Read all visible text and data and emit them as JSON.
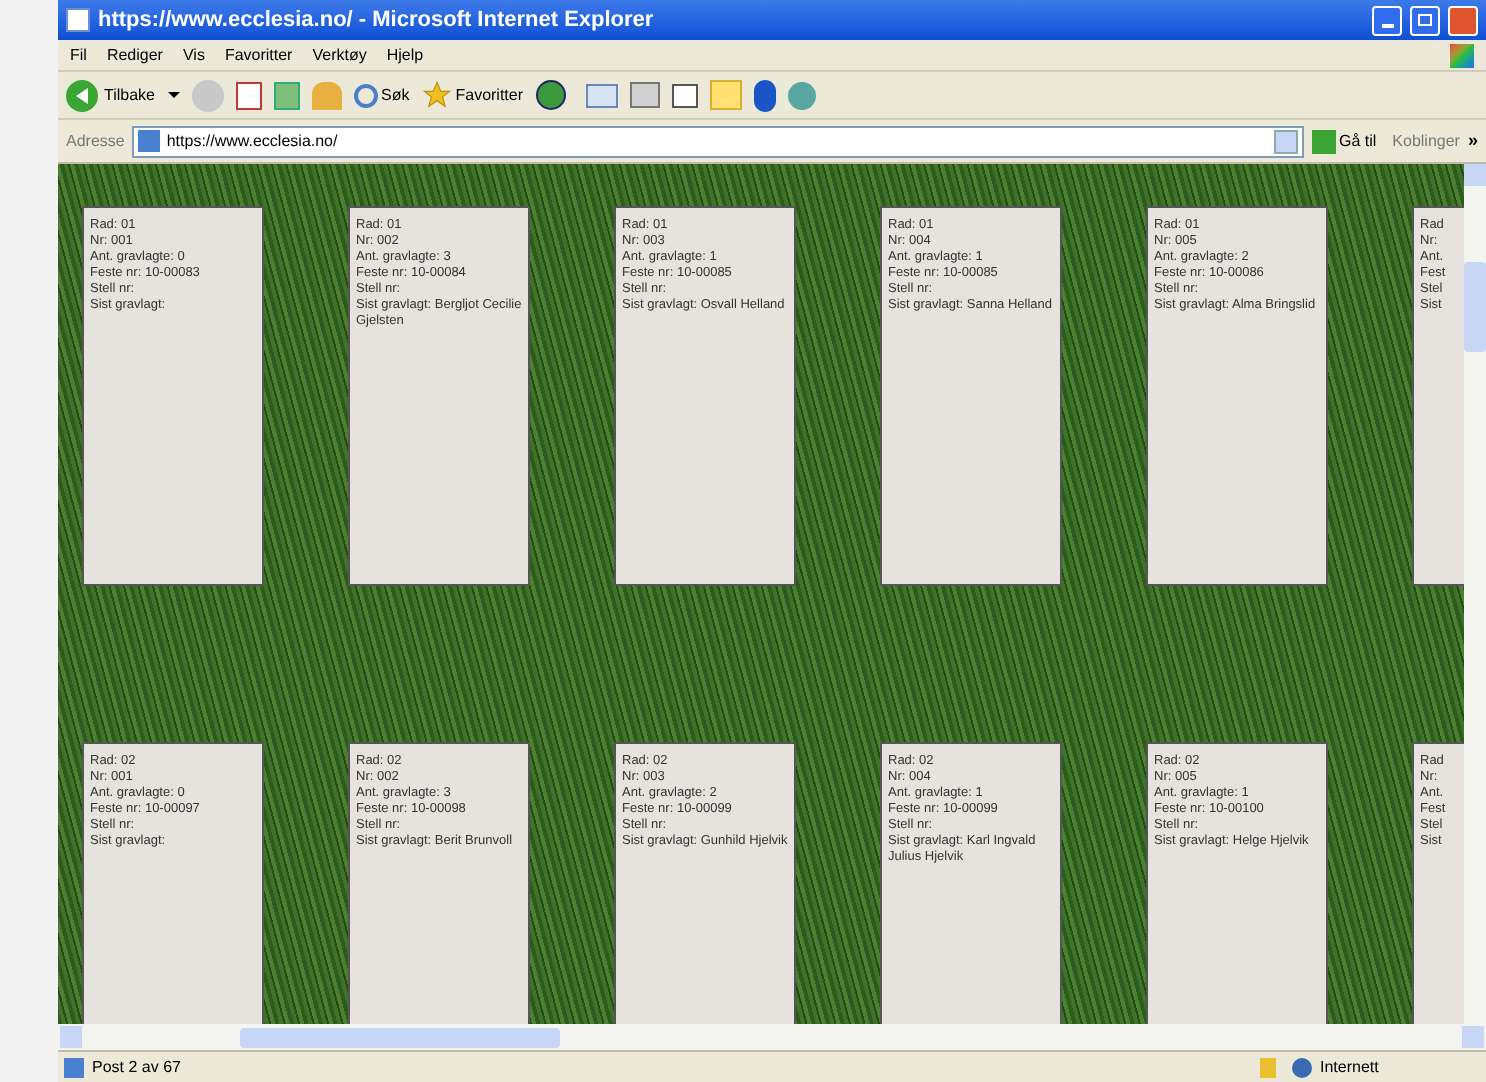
{
  "window": {
    "title": "https://www.ecclesia.no/ - Microsoft Internet Explorer"
  },
  "menu": [
    "Fil",
    "Rediger",
    "Vis",
    "Favoritter",
    "Verktøy",
    "Hjelp"
  ],
  "toolbar": {
    "back": "Tilbake",
    "search": "Søk",
    "favorites": "Favoritter"
  },
  "address": {
    "label": "Adresse",
    "value": "https://www.ecclesia.no/",
    "go": "Gå til",
    "links": "Koblinger",
    "more": "»"
  },
  "rows": [
    {
      "cards": [
        {
          "lines": [
            "Rad: 01",
            "Nr: 001",
            "Ant. gravlagte: 0",
            "Feste nr: 10-00083",
            "Stell nr:",
            "Sist gravlagt:"
          ]
        },
        {
          "lines": [
            "Rad: 01",
            "Nr: 002",
            "Ant. gravlagte: 3",
            "Feste nr: 10-00084",
            "Stell nr:",
            "Sist gravlagt: Bergljot Cecilie Gjelsten"
          ]
        },
        {
          "lines": [
            "Rad: 01",
            "Nr: 003",
            "Ant. gravlagte: 1",
            "Feste nr: 10-00085",
            "Stell nr:",
            "Sist gravlagt: Osvall Helland"
          ]
        },
        {
          "lines": [
            "Rad: 01",
            "Nr: 004",
            "Ant. gravlagte: 1",
            "Feste nr: 10-00085",
            "Stell nr:",
            "Sist gravlagt: Sanna Helland"
          ]
        },
        {
          "lines": [
            "Rad: 01",
            "Nr: 005",
            "Ant. gravlagte: 2",
            "Feste nr: 10-00086",
            "Stell nr:",
            "Sist gravlagt: Alma Bringslid"
          ]
        },
        {
          "lines": [
            "Rad",
            "Nr:",
            "Ant.",
            "Fest",
            "Stel",
            "Sist"
          ]
        }
      ]
    },
    {
      "cards": [
        {
          "lines": [
            "Rad: 02",
            "Nr: 001",
            "Ant. gravlagte: 0",
            "Feste nr: 10-00097",
            "Stell nr:",
            "Sist gravlagt:"
          ]
        },
        {
          "lines": [
            "Rad: 02",
            "Nr: 002",
            "Ant. gravlagte: 3",
            "Feste nr: 10-00098",
            "Stell nr:",
            "Sist gravlagt: Berit Brunvoll"
          ]
        },
        {
          "lines": [
            "Rad: 02",
            "Nr: 003",
            "Ant. gravlagte: 2",
            "Feste nr: 10-00099",
            "Stell nr:",
            "Sist gravlagt: Gunhild Hjelvik"
          ]
        },
        {
          "lines": [
            "Rad: 02",
            "Nr: 004",
            "Ant. gravlagte: 1",
            "Feste nr: 10-00099",
            "Stell nr:",
            "Sist gravlagt: Karl Ingvald Julius Hjelvik"
          ]
        },
        {
          "lines": [
            "Rad: 02",
            "Nr: 005",
            "Ant. gravlagte: 1",
            "Feste nr: 10-00100",
            "Stell nr:",
            "Sist gravlagt: Helge Hjelvik"
          ]
        },
        {
          "lines": [
            "Rad",
            "Nr:",
            "Ant.",
            "Fest",
            "Stel",
            "Sist"
          ]
        }
      ]
    }
  ],
  "status_bar": {
    "text": "Post 2 av 67",
    "zone": "Internett"
  }
}
